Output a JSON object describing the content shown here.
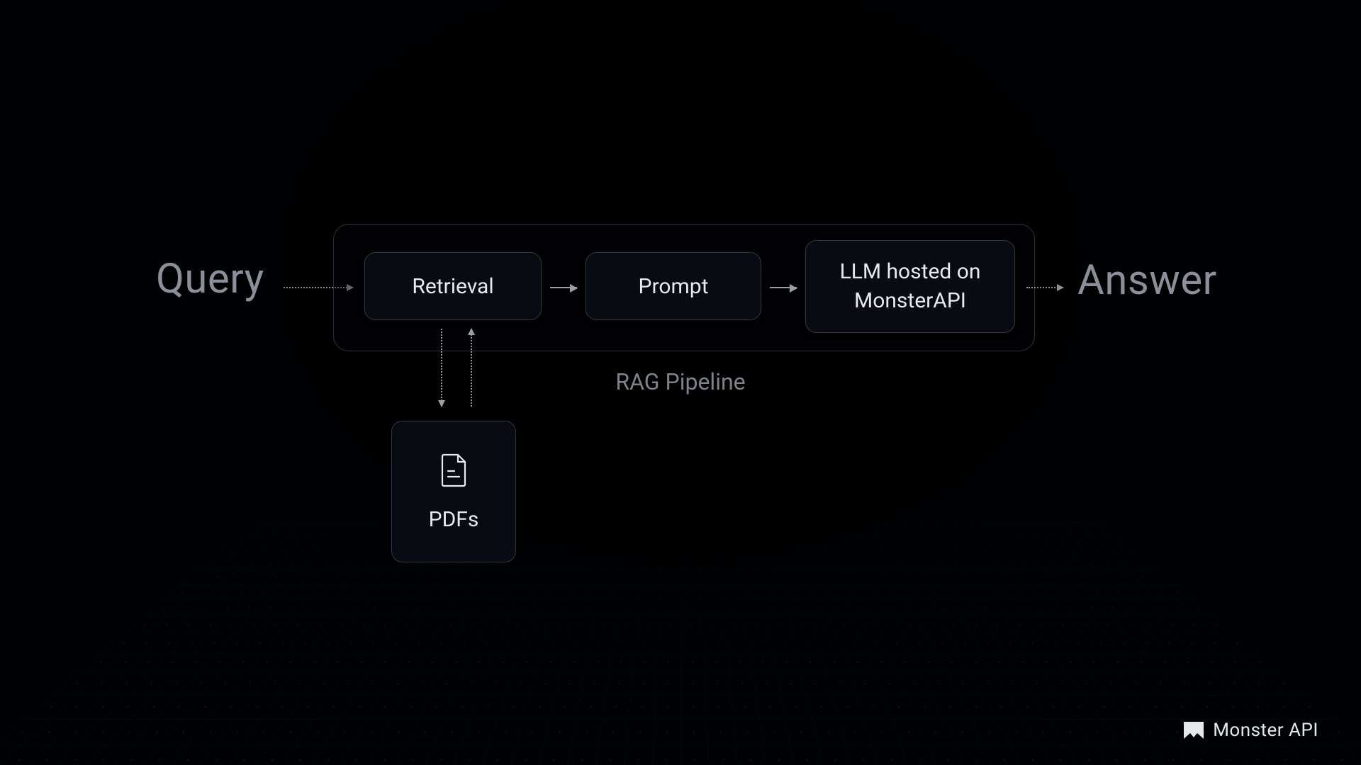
{
  "input_label": "Query",
  "output_label": "Answer",
  "pipeline": {
    "title": "RAG Pipeline",
    "stages": {
      "retrieval": "Retrieval",
      "prompt": "Prompt",
      "llm": "LLM hosted on MonsterAPI"
    }
  },
  "datasource": {
    "label": "PDFs",
    "icon": "document-icon"
  },
  "brand": "Monster API"
}
